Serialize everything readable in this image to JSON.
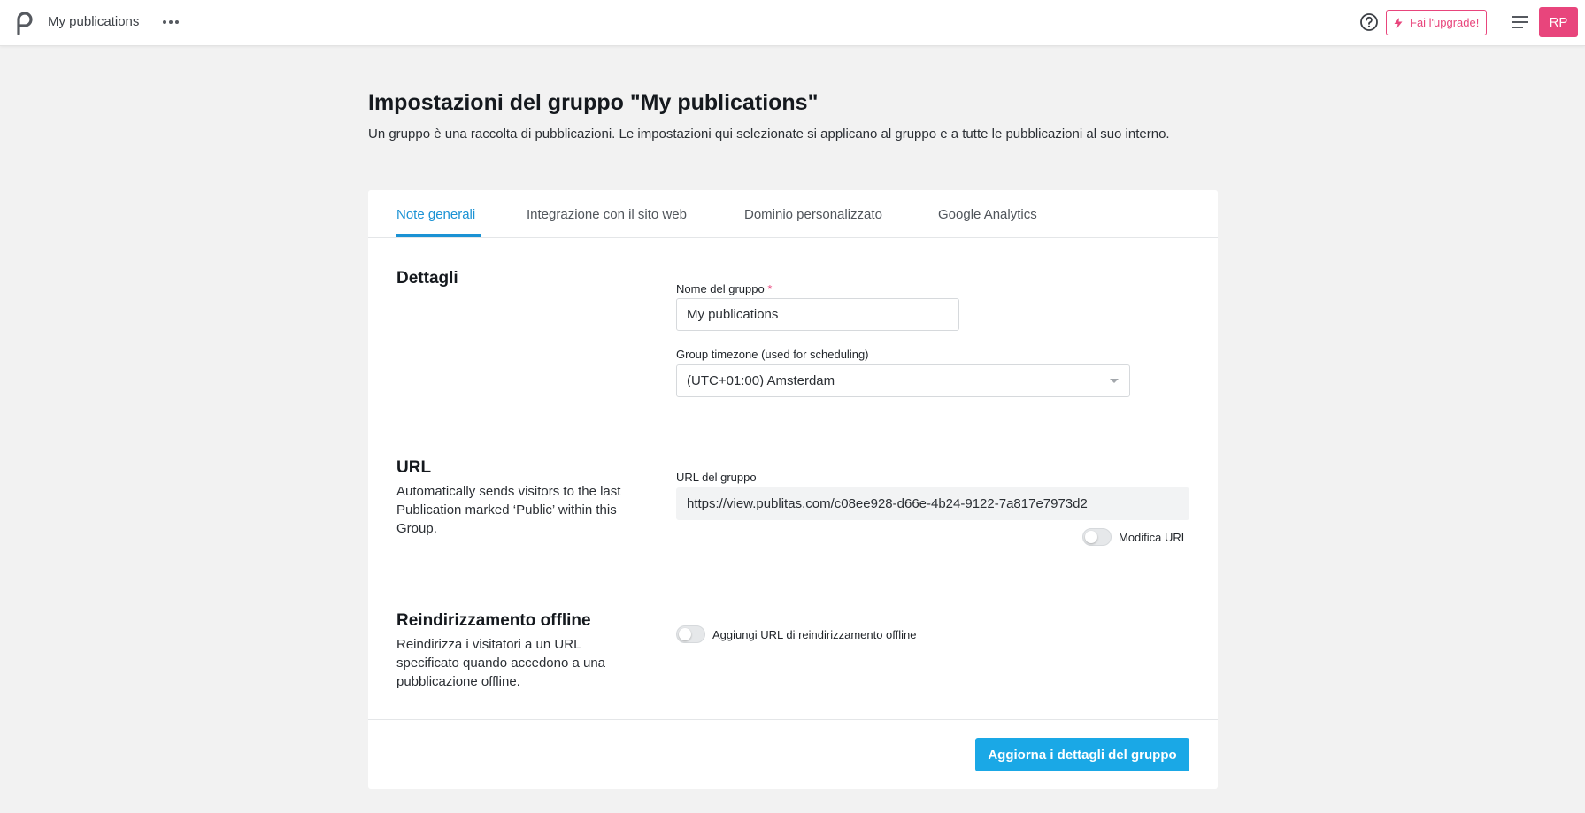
{
  "topbar": {
    "app_title": "My publications",
    "more_icon": "more-horizontal-icon",
    "help_icon": "help-circle-icon",
    "upgrade_label": "Fai l'upgrade!",
    "upgrade_icon": "lightning-icon",
    "menu_icon": "hamburger-menu-icon",
    "avatar_initials": "RP",
    "accent_color": "#e8457c"
  },
  "header": {
    "title": "Impostazioni del gruppo \"My publications\"",
    "description": "Un gruppo è una raccolta di pubblicazioni. Le impostazioni qui selezionate si applicano al gruppo e a tutte le pubblicazioni al suo interno."
  },
  "tabs": [
    {
      "label": "Note generali",
      "active": true
    },
    {
      "label": "Integrazione con il sito web",
      "active": false
    },
    {
      "label": "Dominio personalizzato",
      "active": false
    },
    {
      "label": "Google Analytics",
      "active": false
    }
  ],
  "details": {
    "title": "Dettagli",
    "name_label": "Nome del gruppo",
    "required_mark": "*",
    "name_value": "My publications",
    "timezone_label": "Group timezone (used for scheduling)",
    "timezone_value": "(UTC+01:00) Amsterdam"
  },
  "url": {
    "title": "URL",
    "description": "Automatically sends visitors to the last Publication marked ‘Public’ within this Group.",
    "field_label": "URL del gruppo",
    "field_value": "https://view.publitas.com/c08ee928-d66e-4b24-9122-7a817e7973d2",
    "toggle_label": "Modifica URL",
    "toggle_on": false
  },
  "offline": {
    "title": "Reindirizzamento offline",
    "description": "Reindirizza i visitatori a un URL specificato quando accedono a una pubblicazione offline.",
    "toggle_label": "Aggiungi URL di reindirizzamento offline",
    "toggle_on": false
  },
  "footer": {
    "submit_label": "Aggiorna i dettagli del gruppo",
    "primary_color": "#1aa8e6"
  }
}
